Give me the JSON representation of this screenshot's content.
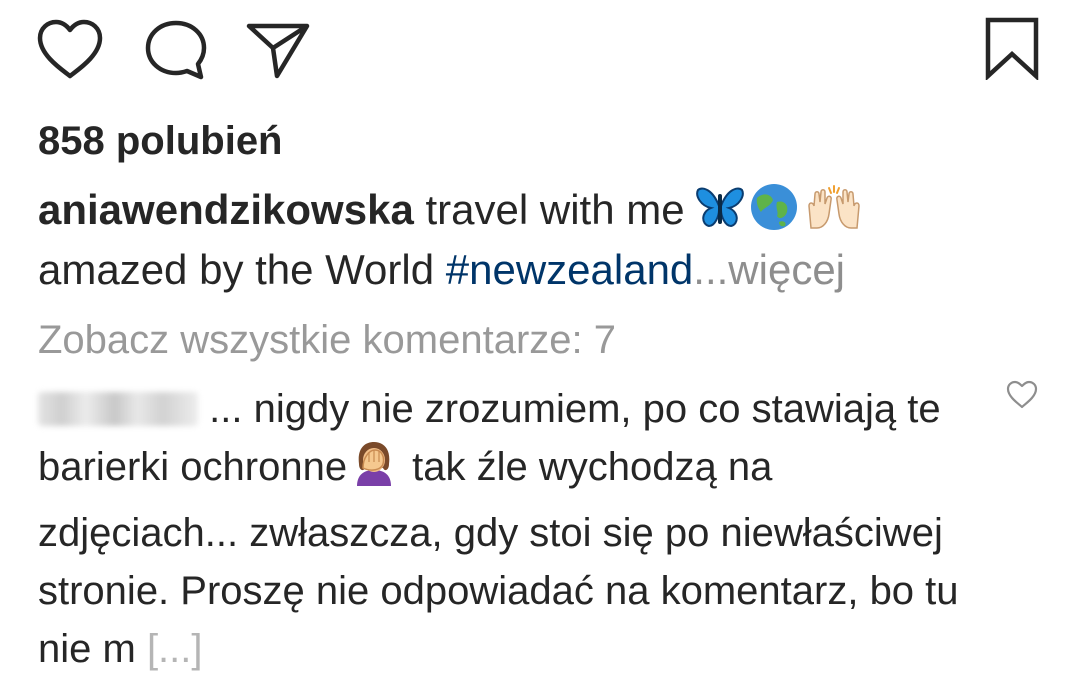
{
  "actions": {
    "like_icon": "heart-outline",
    "comment_icon": "speech-bubble",
    "share_icon": "paper-plane",
    "save_icon": "bookmark-outline"
  },
  "likes_text": "858 polubień",
  "caption": {
    "username": "aniawendzikowska",
    "text_line1": "travel with me",
    "emojis": [
      "butterfly",
      "globe-asia-australia",
      "raised-hands"
    ],
    "text_line2": "amazed by the World",
    "hashtag": "#newzealand",
    "more_label": "...więcej"
  },
  "view_all_comments": "Zobacz wszystkie komentarze: 7",
  "comment": {
    "text_part1": "... nigdy nie zrozumiem, po co stawiają te barierki ochronne",
    "emoji": "person-facepalming",
    "text_part2": " tak źle wychodzą na zdjęciach... zwłaszcza, gdy stoi się po niewłaściwej stronie. Proszę nie odpowiadać na komentarz, bo tu nie m ",
    "truncation": "[...]"
  },
  "colors": {
    "text": "#262626",
    "hashtag": "#003569",
    "muted": "#8e8e8e",
    "view_all": "#999999"
  }
}
